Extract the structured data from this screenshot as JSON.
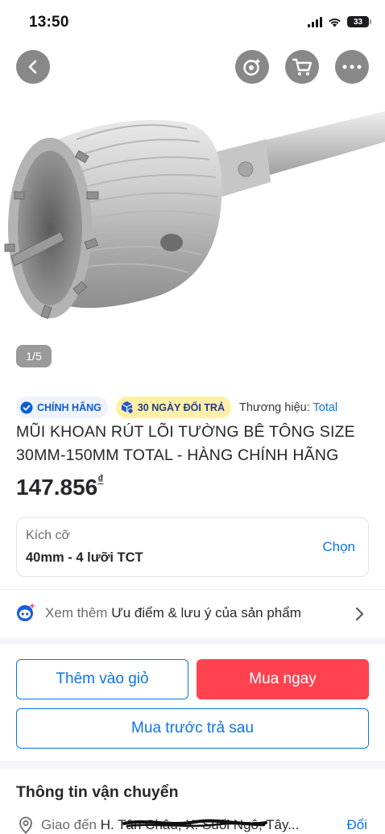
{
  "status_bar": {
    "time": "13:50",
    "battery": "33"
  },
  "header": {
    "back_icon": "chevron-left-icon",
    "ai_icon": "ai-sparkle-icon",
    "cart_icon": "cart-icon",
    "more_icon": "more-dots-icon"
  },
  "gallery": {
    "counter": "1/5"
  },
  "badges": {
    "official": "CHÍNH HÃNG",
    "return": "30 NGÀY ĐỔI TRẢ",
    "brand_prefix": "Thương hiệu: ",
    "brand_name": "Total"
  },
  "product": {
    "title": "MŨI KHOAN RÚT LÕI TƯỜNG BÊ TÔNG SIZE 30MM-150MM TOTAL - HÀNG CHÍNH HÃNG",
    "price": "147.856",
    "currency": "₫"
  },
  "variant": {
    "label": "Kích cỡ",
    "value": "40mm - 4 lưỡi TCT",
    "choose": "Chọn"
  },
  "more_info": {
    "prefix": "Xem thêm ",
    "text": "Ưu điểm & lưu ý của sản phẩm"
  },
  "actions": {
    "add_to_cart": "Thêm vào giỏ",
    "buy_now": "Mua ngay",
    "buy_later": "Mua trước trả sau"
  },
  "shipping": {
    "title": "Thông tin vận chuyển",
    "deliver_prefix": "Giao đến ",
    "address": "H. Tân Châu, X. Suối Ngô, Tây...",
    "change": "Đổi"
  },
  "colors": {
    "accent_blue": "#0b74e5",
    "buy_red": "#ff424f",
    "text_dark": "#27272a"
  }
}
